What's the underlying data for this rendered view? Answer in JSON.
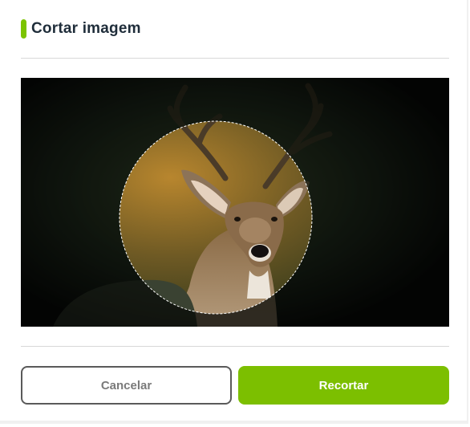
{
  "dialog": {
    "title": "Cortar imagem",
    "accent_color": "#7cc400"
  },
  "cropper": {
    "image_subject": "deer",
    "crop_shape": "circle"
  },
  "actions": {
    "cancel_label": "Cancelar",
    "crop_label": "Recortar",
    "primary_color": "#7cbf00"
  }
}
